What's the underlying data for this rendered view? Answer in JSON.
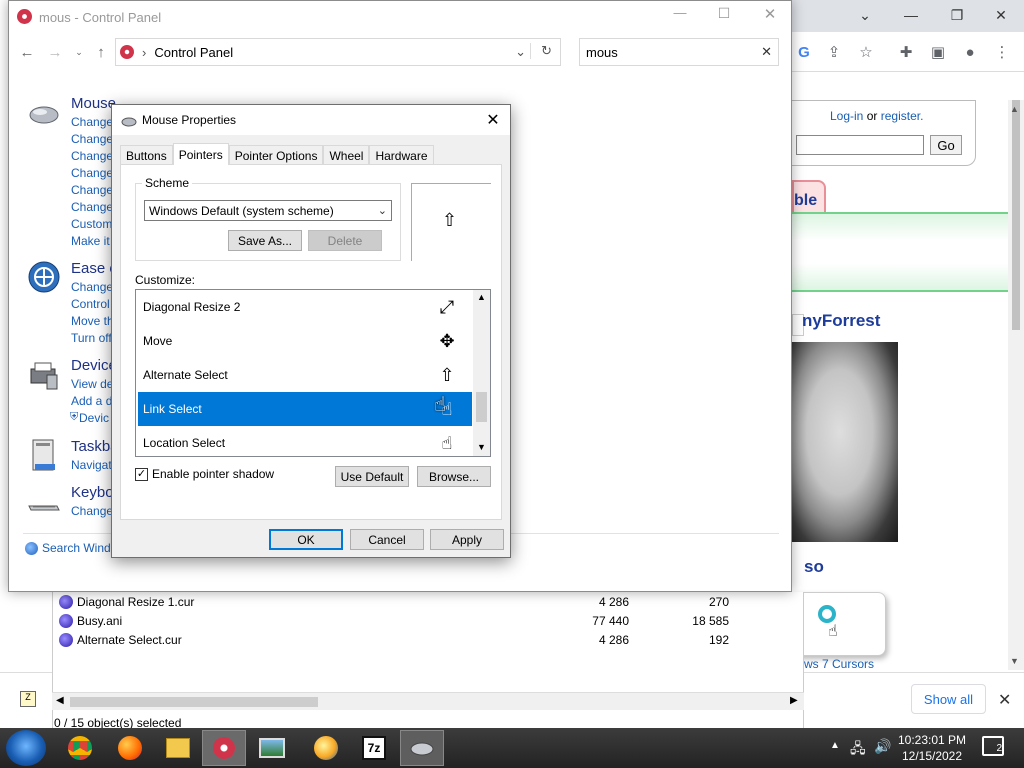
{
  "browser": {
    "login_text": "Log-in",
    "or_text": "or",
    "register_text": "register.",
    "go_label": "Go",
    "tab_partial": "ble",
    "user_partial": "nyForrest",
    "also_partial": "so",
    "cursors_link_partial": "ws 7 Cursors",
    "show_all": "Show all"
  },
  "explorer": {
    "files": [
      {
        "name": "Diagonal Resize 1.cur",
        "size": "4 286",
        "col2": "270"
      },
      {
        "name": "Busy.ani",
        "size": "77 440",
        "col2": "18 585"
      },
      {
        "name": "Alternate Select.cur",
        "size": "4 286",
        "col2": "192"
      }
    ],
    "status": "0 / 15 object(s) selected"
  },
  "control_panel": {
    "title": "mous - Control Panel",
    "breadcrumb": "Control Panel",
    "search_value": "mous",
    "categories": [
      {
        "title": "Mouse",
        "links": [
          "Change",
          "Change",
          "Change",
          "Change",
          "Change",
          "Change",
          "Custom",
          "Make it"
        ]
      },
      {
        "title": "Ease o",
        "links": [
          "Change",
          "Control",
          "Move th",
          "Turn off"
        ]
      },
      {
        "title": "Device",
        "links": [
          "View de",
          "Add a d",
          "Devic"
        ]
      },
      {
        "title": "Taskba",
        "links": [
          "Navigat"
        ]
      },
      {
        "title": "Keybo",
        "links": [
          "Change"
        ]
      }
    ],
    "search_windows": "Search Windo"
  },
  "dialog": {
    "title": "Mouse Properties",
    "tabs": [
      "Buttons",
      "Pointers",
      "Pointer Options",
      "Wheel",
      "Hardware"
    ],
    "active_tab": "Pointers",
    "scheme_label": "Scheme",
    "scheme_value": "Windows Default (system scheme)",
    "save_as": "Save As...",
    "delete": "Delete",
    "customize_label": "Customize:",
    "cursor_rows": [
      {
        "name": "Diagonal Resize 2",
        "icon": "diagonal-resize-icon"
      },
      {
        "name": "Move",
        "icon": "move-icon"
      },
      {
        "name": "Alternate Select",
        "icon": "up-arrow-icon"
      },
      {
        "name": "Link Select",
        "icon": "hand-pointer-icon",
        "selected": true
      },
      {
        "name": "Location Select",
        "icon": "location-select-icon"
      }
    ],
    "enable_shadow": "Enable pointer shadow",
    "use_default": "Use Default",
    "browse": "Browse...",
    "ok": "OK",
    "cancel": "Cancel",
    "apply": "Apply"
  },
  "taskbar": {
    "time": "10:23:01 PM",
    "date": "12/15/2022",
    "notification_count": "2"
  }
}
